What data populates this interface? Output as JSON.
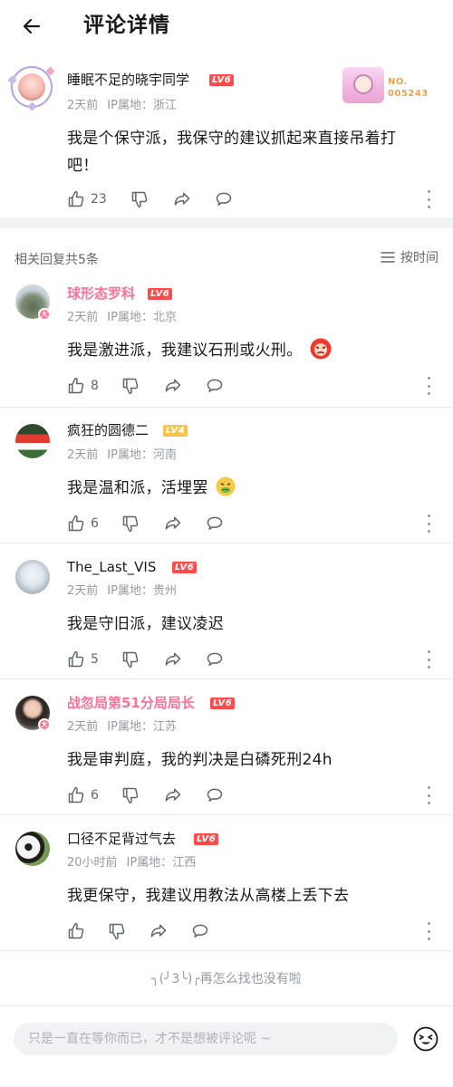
{
  "header": {
    "title": "评论详情",
    "back_icon": "arrow-left-icon"
  },
  "main_comment": {
    "username": "睡眠不足的晓宇同学",
    "level": "LV6",
    "time": "2天前",
    "ip": "IP属地：浙江",
    "content_line1": "我是个保守派，我保守的建议抓起来直接吊着打",
    "content_line2": "吧！",
    "likes": "23",
    "fan_no_label": "NO.",
    "fan_no": "005243"
  },
  "reply_header": {
    "count_label": "相关回复共5条",
    "sort_label": "按时间"
  },
  "replies": [
    {
      "username": "球形态罗科",
      "level": "LV6",
      "level_color": "#ff4b4b",
      "vip": true,
      "time": "2天前",
      "ip": "IP属地：北京",
      "content": "我是激进派，我建议石刑或火刑。",
      "likes": "8"
    },
    {
      "username": "疯狂的圆德二",
      "level": "LV4",
      "level_color": "#f8c449",
      "vip": false,
      "time": "2天前",
      "ip": "IP属地：河南",
      "content": "我是温和派，活埋罢",
      "likes": "6"
    },
    {
      "username": "The_Last_VIS",
      "level": "LV6",
      "level_color": "#ff4b4b",
      "vip": false,
      "time": "2天前",
      "ip": "IP属地：贵州",
      "content": "我是守旧派，建议凌迟",
      "likes": "5"
    },
    {
      "username": "战忽局第51分局局长",
      "level": "LV6",
      "level_color": "#ff4b4b",
      "vip": true,
      "time": "2天前",
      "ip": "IP属地：江苏",
      "content": "我是审判庭，我的判决是白磷死刑24h",
      "likes": "6"
    },
    {
      "username": "口径不足背过气去",
      "level": "LV6",
      "level_color": "#ff4b4b",
      "vip": false,
      "time": "20小时前",
      "ip": "IP属地：江西",
      "content": "我更保守，我建议用教法从高楼上丢下去",
      "likes": ""
    }
  ],
  "end_tip": "╮(╯3╰)╭再怎么找也没有啦",
  "input": {
    "placeholder": "只是一直在等你而已，才不是想被评论呢 ~"
  },
  "colors": {
    "brand_pink": "#fb7299",
    "level_red": "#ff4b4b",
    "level_yellow": "#f8c449",
    "meta_gray": "#9499a0"
  }
}
